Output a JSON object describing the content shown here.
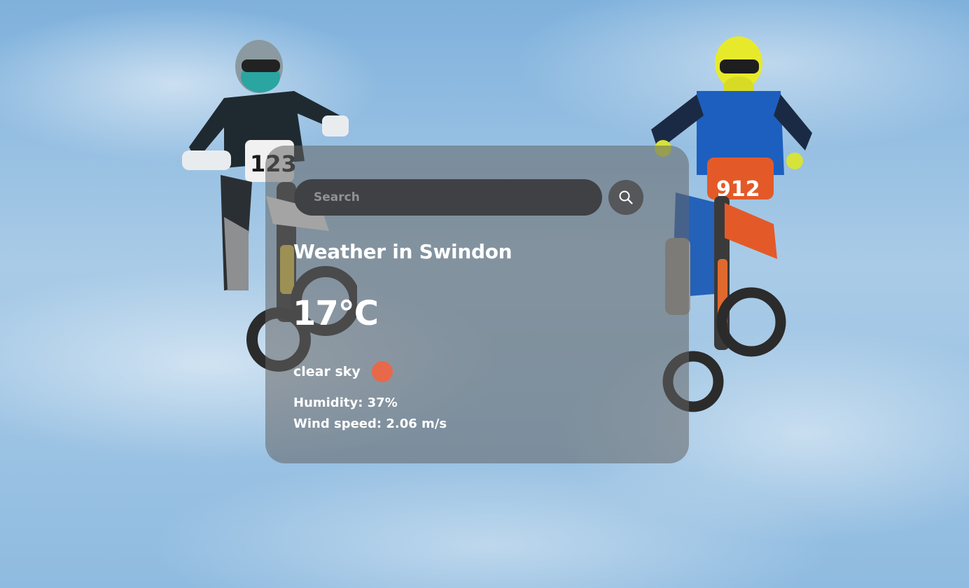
{
  "search": {
    "placeholder": "Search",
    "value": ""
  },
  "weather": {
    "heading": "Weather in Swindon",
    "temperature": "17°C",
    "description": "clear sky",
    "icon": "sun-icon",
    "humidity": "Humidity: 37%",
    "wind": "Wind speed: 2.06 m/s"
  },
  "colors": {
    "icon_sun": "#e8684a",
    "card_bg": "rgba(100,100,100,0.55)",
    "search_bg": "#3f4144",
    "button_bg": "#55575a"
  },
  "background": {
    "icon": "motocross-riders-photo"
  }
}
